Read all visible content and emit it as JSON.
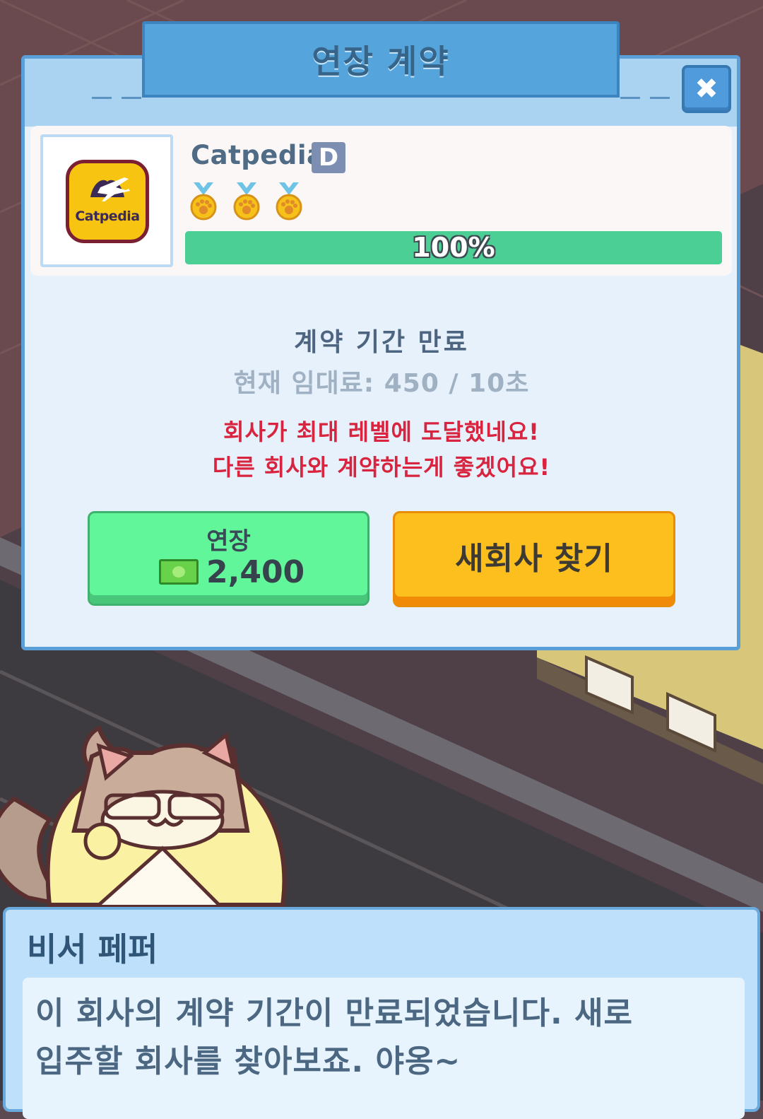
{
  "modal": {
    "title": "연장 계약",
    "close_icon": "close-icon",
    "company": {
      "logo_text": "Catpedia",
      "name": "Catpedia",
      "grade": "D",
      "medals": 3,
      "progress": 1.0,
      "progress_label": "100%"
    },
    "status": "계약 기간 만료",
    "rent": "현재 임대료: 450 / 10초",
    "warning_lines": [
      "회사가 최대 레벨에 도달했네요!",
      "다른 회사와 계약하는게 좋겠어요!"
    ],
    "renew_button": {
      "label": "연장",
      "price": "2,400",
      "icon": "cash-icon"
    },
    "new_company_button": {
      "label": "새회사 찾기"
    }
  },
  "dialog": {
    "speaker": "비서 페퍼",
    "lines": [
      "이 회사의 계약 기간이 만료되었습니다. 새로",
      "입주할 회사를 찾아보죠. 야옹~"
    ]
  },
  "colors": {
    "accent_blue": "#55a4db",
    "progress_green": "#4ccf95",
    "warning_red": "#d8243f",
    "renew_green": "#62f69a",
    "new_orange": "#fdbf1d"
  }
}
